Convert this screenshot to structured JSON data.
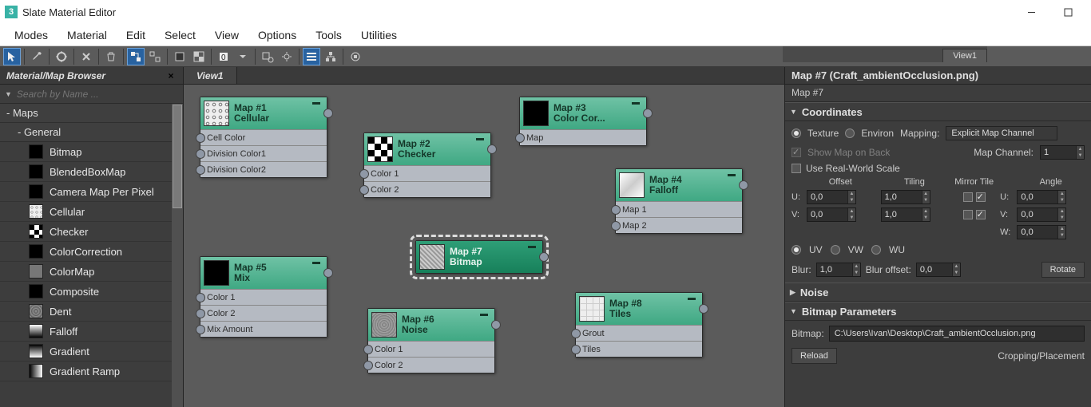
{
  "window": {
    "title": "Slate Material Editor"
  },
  "menu": [
    "Modes",
    "Material",
    "Edit",
    "Select",
    "View",
    "Options",
    "Tools",
    "Utilities"
  ],
  "browser": {
    "title": "Material/Map Browser",
    "search_placeholder": "Search by Name ...",
    "groups": {
      "maps": "- Maps",
      "general": "- General"
    },
    "items": [
      {
        "label": "Bitmap",
        "swatch": "#000"
      },
      {
        "label": "BlendedBoxMap",
        "swatch": "#000"
      },
      {
        "label": "Camera Map Per Pixel",
        "swatch": "#000"
      },
      {
        "label": "Cellular",
        "swatch": "cellular"
      },
      {
        "label": "Checker",
        "swatch": "checker"
      },
      {
        "label": "ColorCorrection",
        "swatch": "#000"
      },
      {
        "label": "ColorMap",
        "swatch": "#777"
      },
      {
        "label": "Composite",
        "swatch": "#000"
      },
      {
        "label": "Dent",
        "swatch": "dent"
      },
      {
        "label": "Falloff",
        "swatch": "falloff"
      },
      {
        "label": "Gradient",
        "swatch": "gradient"
      },
      {
        "label": "Gradient Ramp",
        "swatch": "gradientramp"
      }
    ]
  },
  "view": {
    "tab": "View1"
  },
  "nodes": {
    "n1": {
      "name": "Map #1",
      "type": "Cellular",
      "slots": [
        "Cell Color",
        "Division Color1",
        "Division Color2"
      ],
      "thumb": "cellular"
    },
    "n2": {
      "name": "Map #2",
      "type": "Checker",
      "slots": [
        "Color 1",
        "Color 2"
      ],
      "thumb": "checker"
    },
    "n3": {
      "name": "Map #3",
      "type": "Color Cor...",
      "slots": [
        "Map"
      ],
      "thumb": "#000"
    },
    "n4": {
      "name": "Map #4",
      "type": "Falloff",
      "slots": [
        "Map 1",
        "Map 2"
      ],
      "thumb": "falloff"
    },
    "n5": {
      "name": "Map #5",
      "type": "Mix",
      "slots": [
        "Color 1",
        "Color 2",
        "Mix Amount"
      ],
      "thumb": "#000"
    },
    "n6": {
      "name": "Map #6",
      "type": "Noise",
      "slots": [
        "Color 1",
        "Color 2"
      ],
      "thumb": "noise"
    },
    "n7": {
      "name": "Map #7",
      "type": "Bitmap",
      "slots": [],
      "thumb": "bitmap"
    },
    "n8": {
      "name": "Map #8",
      "type": "Tiles",
      "slots": [
        "Grout",
        "Tiles"
      ],
      "thumb": "tiles"
    }
  },
  "right": {
    "tab": "View1",
    "title": "Map #7 (Craft_ambientOcclusion.png)",
    "subtitle": "Map #7",
    "coordinates": {
      "heading": "Coordinates",
      "texture": "Texture",
      "environ": "Environ",
      "mapping_label": "Mapping:",
      "mapping_value": "Explicit Map Channel",
      "show_map_back": "Show Map on Back",
      "map_channel_label": "Map Channel:",
      "map_channel_value": "1",
      "real_world": "Use Real-World Scale",
      "col_offset": "Offset",
      "col_tiling": "Tiling",
      "col_mirror": "Mirror Tile",
      "col_angle": "Angle",
      "u": "U:",
      "v": "V:",
      "w": "W:",
      "u_offset": "0,0",
      "u_tiling": "1,0",
      "u_angle": "0,0",
      "v_offset": "0,0",
      "v_tiling": "1,0",
      "v_angle": "0,0",
      "w_angle": "0,0",
      "uv": "UV",
      "vw": "VW",
      "wu": "WU",
      "blur_label": "Blur:",
      "blur": "1,0",
      "blur_off_label": "Blur offset:",
      "blur_off": "0,0",
      "rotate": "Rotate"
    },
    "noise": {
      "heading": "Noise"
    },
    "bitmap_params": {
      "heading": "Bitmap Parameters",
      "bitmap_label": "Bitmap:",
      "bitmap_path": "C:\\Users\\Ivan\\Desktop\\Craft_ambientOcclusion.png",
      "reload": "Reload",
      "cropping": "Cropping/Placement"
    }
  }
}
